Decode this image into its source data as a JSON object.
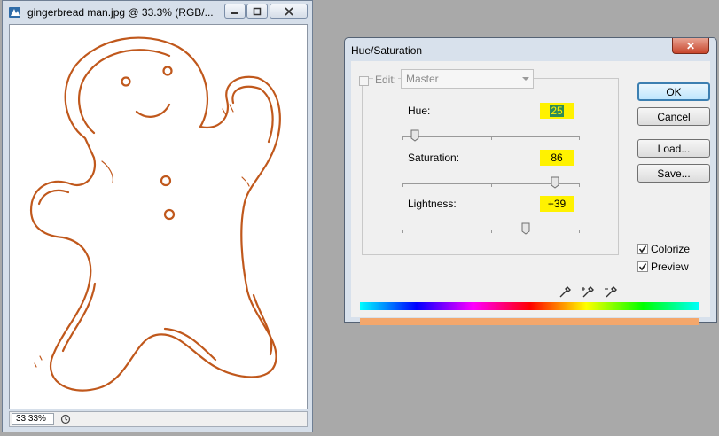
{
  "document_window": {
    "title": "gingerbread man.jpg @ 33.3% (RGB/...",
    "zoom": "33.33%",
    "stroke_color": "#c0581c"
  },
  "dialog": {
    "title": "Hue/Saturation",
    "close_label": "✕",
    "edit_label": "Edit:",
    "edit_value": "Master",
    "hue": {
      "label": "Hue:",
      "value": "25",
      "level": 0.07
    },
    "saturation": {
      "label": "Saturation:",
      "value": "86",
      "level": 0.86
    },
    "lightness": {
      "label": "Lightness:",
      "value": "+39",
      "level": 0.695
    },
    "buttons": {
      "ok": "OK",
      "cancel": "Cancel",
      "load": "Load...",
      "save": "Save..."
    },
    "colorize": {
      "label": "Colorize",
      "checked": true
    },
    "preview": {
      "label": "Preview",
      "checked": true
    },
    "highlight_color": "#fff200",
    "result_color": "#f4a76c"
  }
}
